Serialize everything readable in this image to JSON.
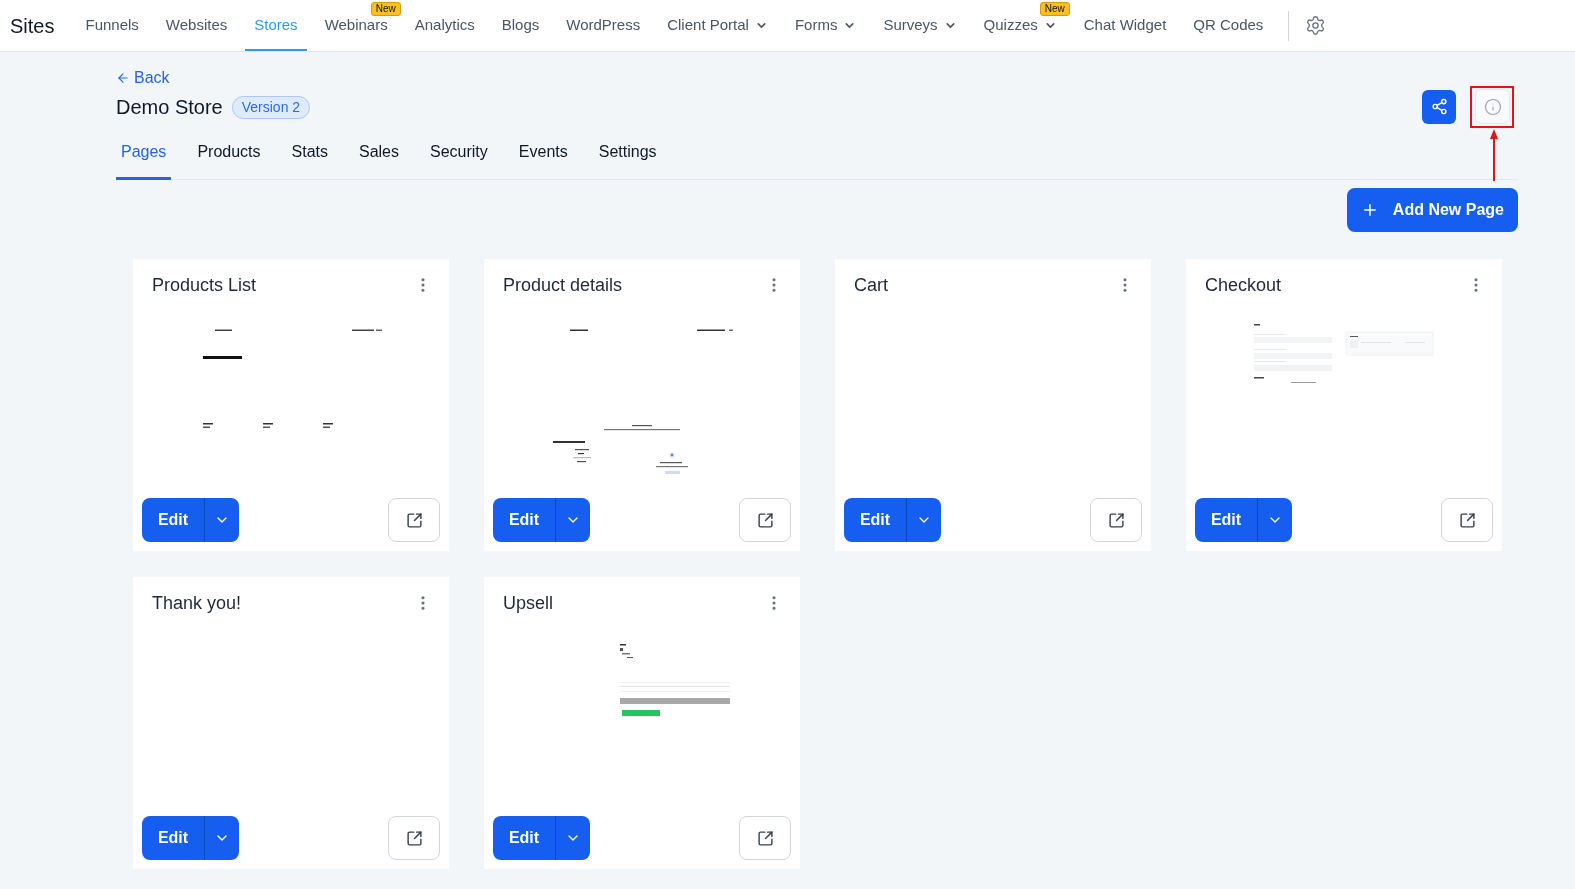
{
  "nav": {
    "brand": "Sites",
    "items": [
      {
        "label": "Funnels",
        "selected": false,
        "dropdown": false
      },
      {
        "label": "Websites",
        "selected": false,
        "dropdown": false
      },
      {
        "label": "Stores",
        "selected": true,
        "dropdown": false
      },
      {
        "label": "Webinars",
        "selected": false,
        "dropdown": false,
        "badge": "New"
      },
      {
        "label": "Analytics",
        "selected": false,
        "dropdown": false
      },
      {
        "label": "Blogs",
        "selected": false,
        "dropdown": false
      },
      {
        "label": "WordPress",
        "selected": false,
        "dropdown": false
      },
      {
        "label": "Client Portal",
        "selected": false,
        "dropdown": true
      },
      {
        "label": "Forms",
        "selected": false,
        "dropdown": true
      },
      {
        "label": "Surveys",
        "selected": false,
        "dropdown": true
      },
      {
        "label": "Quizzes",
        "selected": false,
        "dropdown": true,
        "badge": "New"
      },
      {
        "label": "Chat Widget",
        "selected": false,
        "dropdown": false
      },
      {
        "label": "QR Codes",
        "selected": false,
        "dropdown": false
      }
    ]
  },
  "header": {
    "back": "Back",
    "title": "Demo Store",
    "version": "Version 2",
    "info_highlighted": true
  },
  "tabs": [
    {
      "label": "Pages",
      "selected": true
    },
    {
      "label": "Products",
      "selected": false
    },
    {
      "label": "Stats",
      "selected": false
    },
    {
      "label": "Sales",
      "selected": false
    },
    {
      "label": "Security",
      "selected": false
    },
    {
      "label": "Events",
      "selected": false
    },
    {
      "label": "Settings",
      "selected": false
    }
  ],
  "add_page": "Add New Page",
  "pages": [
    {
      "title": "Products List",
      "kind": "catalog",
      "edit": "Edit"
    },
    {
      "title": "Product details",
      "kind": "details",
      "edit": "Edit"
    },
    {
      "title": "Cart",
      "kind": "blank",
      "edit": "Edit"
    },
    {
      "title": "Checkout",
      "kind": "checkout",
      "edit": "Edit"
    },
    {
      "title": "Thank you!",
      "kind": "blank",
      "edit": "Edit"
    },
    {
      "title": "Upsell",
      "kind": "upsell",
      "edit": "Edit"
    }
  ]
}
